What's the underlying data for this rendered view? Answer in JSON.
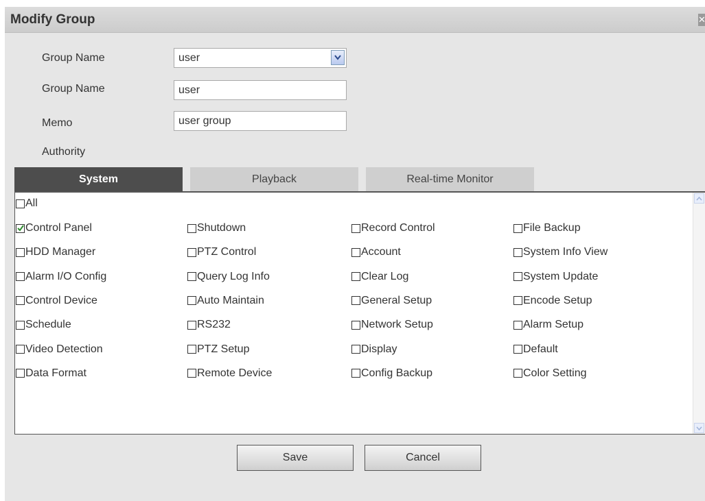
{
  "dialog": {
    "title": "Modify Group",
    "close_icon": "close-icon"
  },
  "form": {
    "group_select": {
      "label": "Group Name",
      "value": "user"
    },
    "group_name": {
      "label": "Group Name",
      "value": "user"
    },
    "memo": {
      "label": "Memo",
      "value": "user group"
    },
    "authority_label": "Authority"
  },
  "tabs": [
    {
      "label": "System",
      "active": true
    },
    {
      "label": "Playback",
      "active": false
    },
    {
      "label": "Real-time Monitor",
      "active": false
    }
  ],
  "permissions": {
    "all": {
      "label": "All",
      "checked": false
    },
    "items": [
      {
        "label": "Control Panel",
        "checked": true
      },
      {
        "label": "Shutdown",
        "checked": false
      },
      {
        "label": "Record Control",
        "checked": false
      },
      {
        "label": "File Backup",
        "checked": false
      },
      {
        "label": "HDD Manager",
        "checked": false
      },
      {
        "label": "PTZ Control",
        "checked": false
      },
      {
        "label": "Account",
        "checked": false
      },
      {
        "label": "System Info View",
        "checked": false
      },
      {
        "label": "Alarm I/O Config",
        "checked": false
      },
      {
        "label": "Query Log Info",
        "checked": false
      },
      {
        "label": "Clear Log",
        "checked": false
      },
      {
        "label": "System Update",
        "checked": false
      },
      {
        "label": "Control Device",
        "checked": false
      },
      {
        "label": "Auto Maintain",
        "checked": false
      },
      {
        "label": "General Setup",
        "checked": false
      },
      {
        "label": "Encode Setup",
        "checked": false
      },
      {
        "label": "Schedule",
        "checked": false
      },
      {
        "label": "RS232",
        "checked": false
      },
      {
        "label": "Network Setup",
        "checked": false
      },
      {
        "label": "Alarm Setup",
        "checked": false
      },
      {
        "label": "Video Detection",
        "checked": false
      },
      {
        "label": "PTZ Setup",
        "checked": false
      },
      {
        "label": "Display",
        "checked": false
      },
      {
        "label": "Default",
        "checked": false
      },
      {
        "label": "Data Format",
        "checked": false
      },
      {
        "label": "Remote Device",
        "checked": false
      },
      {
        "label": "Config Backup",
        "checked": false
      },
      {
        "label": "Color Setting",
        "checked": false
      }
    ]
  },
  "buttons": {
    "save_label": "Save",
    "cancel_label": "Cancel"
  },
  "colors": {
    "active_tab": "#4d4d4d",
    "inactive_tab": "#cfcfcf",
    "dialog_background": "#e6e6e6",
    "check_mark": "#2e8b2e"
  }
}
